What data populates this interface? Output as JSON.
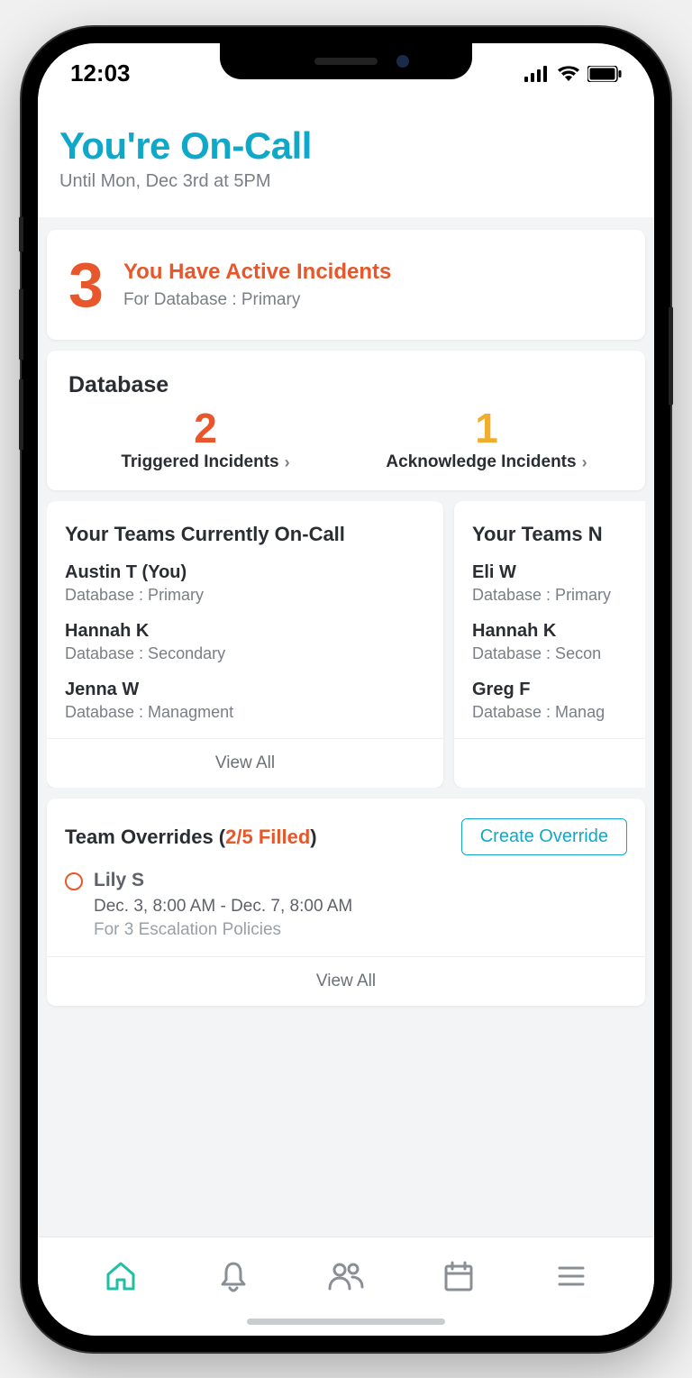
{
  "status": {
    "time": "12:03"
  },
  "header": {
    "title": "You're On-Call",
    "subtitle": "Until Mon, Dec 3rd at 5PM"
  },
  "active_incidents": {
    "count": "3",
    "title": "You Have Active Incidents",
    "subtitle": "For Database : Primary"
  },
  "database_section": {
    "title": "Database",
    "triggered": {
      "count": "2",
      "label": "Triggered Incidents"
    },
    "acknowledged": {
      "count": "1",
      "label": "Acknowledge Incidents"
    }
  },
  "teams_current": {
    "title": "Your Teams Currently On-Call",
    "members": [
      {
        "name": "Austin T (You)",
        "role": "Database : Primary"
      },
      {
        "name": "Hannah K",
        "role": "Database : Secondary"
      },
      {
        "name": "Jenna W",
        "role": "Database : Managment"
      }
    ],
    "view_all": "View All"
  },
  "teams_next": {
    "title": "Your Teams N",
    "members": [
      {
        "name": "Eli W",
        "role": "Database : Primary"
      },
      {
        "name": "Hannah K",
        "role": "Database : Secon"
      },
      {
        "name": "Greg F",
        "role": "Database : Manag"
      }
    ]
  },
  "overrides": {
    "title_prefix": "Team Overrides (",
    "filled": "2/5 Filled",
    "title_suffix": ")",
    "create_label": "Create Override",
    "item": {
      "name": "Lily S",
      "time": "Dec. 3, 8:00 AM - Dec. 7, 8:00 AM",
      "policies": "For 3 Escalation Policies"
    },
    "view_all": "View All"
  },
  "colors": {
    "accent_teal": "#10a8c9",
    "accent_orange": "#e8572b",
    "accent_yellow": "#f0ad2e"
  }
}
